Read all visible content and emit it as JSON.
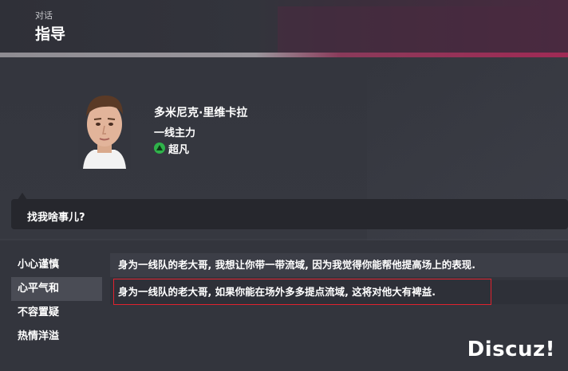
{
  "header": {
    "subtitle": "对话",
    "title": "指导"
  },
  "player": {
    "name": "多米尼克·里维卡拉",
    "role": "一线主力",
    "rating_label": "超凡",
    "rating_color": "#2fb24a"
  },
  "dialog": {
    "prompt": "找我啥事儿?"
  },
  "tones": [
    {
      "label": "小心谨慎"
    },
    {
      "label": "心平气和"
    },
    {
      "label": "不容置疑"
    },
    {
      "label": "热情洋溢"
    }
  ],
  "selected_tone": "心平气和",
  "options": [
    {
      "text": "身为一线队的老大哥, 我想让你带一带流域, 因为我觉得你能帮他提高场上的表现."
    },
    {
      "text": "身为一线队的老大哥, 如果你能在场外多多提点流域, 这将对他大有裨益."
    }
  ],
  "watermark": "Discuz!",
  "colors": {
    "accent": "#a02a55",
    "highlight_border": "#e0222e"
  }
}
